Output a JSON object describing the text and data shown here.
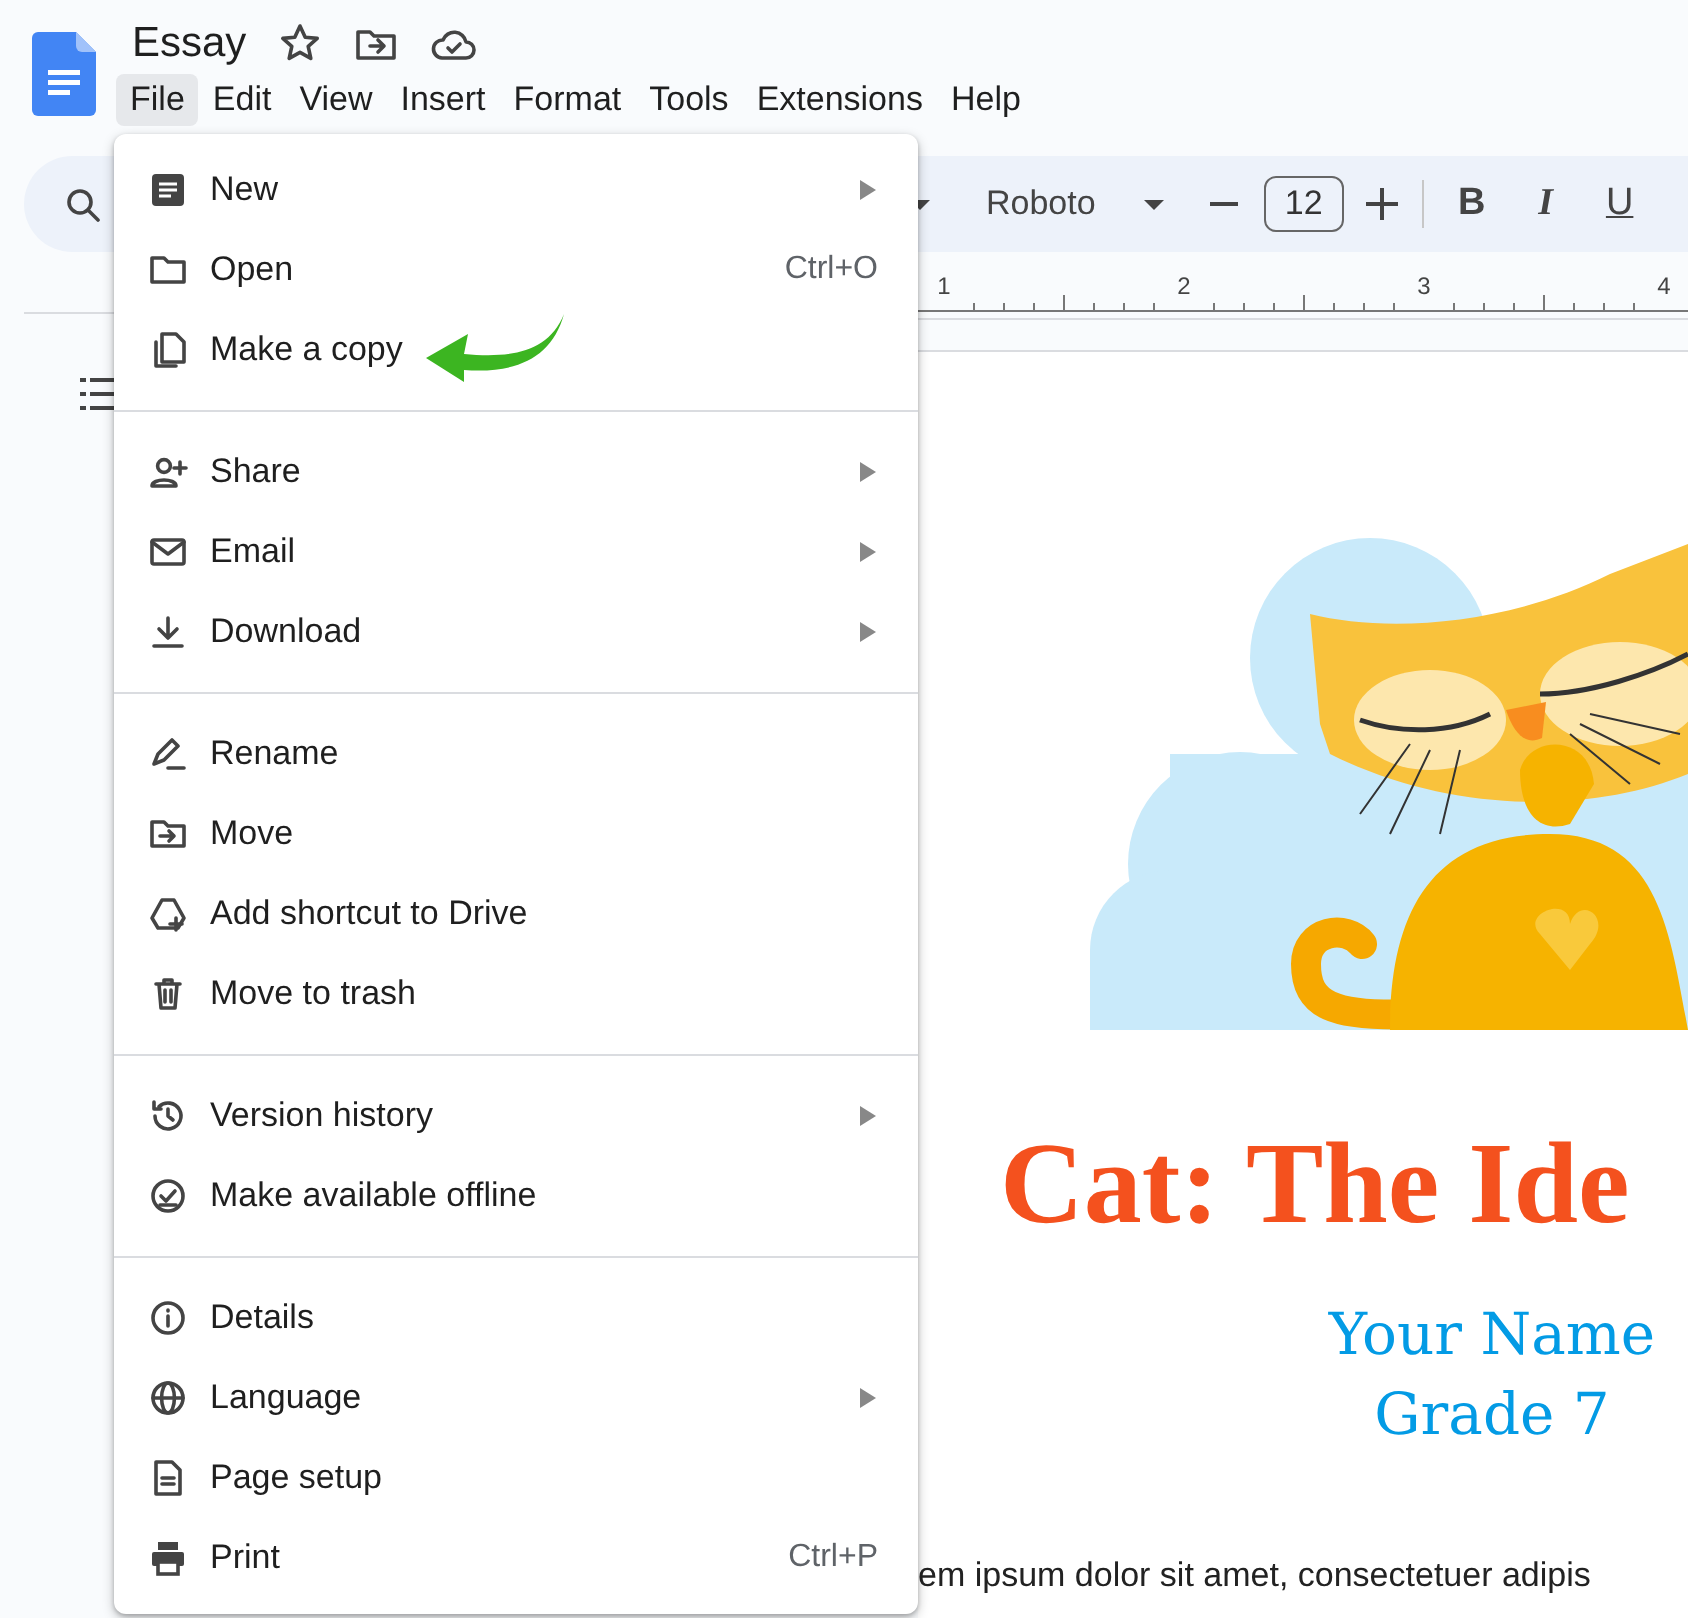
{
  "document": {
    "title": "Essay"
  },
  "menubar": [
    {
      "label": "File",
      "selected": true
    },
    {
      "label": "Edit",
      "selected": false
    },
    {
      "label": "View",
      "selected": false
    },
    {
      "label": "Insert",
      "selected": false
    },
    {
      "label": "Format",
      "selected": false
    },
    {
      "label": "Tools",
      "selected": false
    },
    {
      "label": "Extensions",
      "selected": false
    },
    {
      "label": "Help",
      "selected": false
    }
  ],
  "toolbar": {
    "font": "Roboto",
    "font_size": "12",
    "styles": [
      {
        "label": "B",
        "kind": "bold"
      },
      {
        "label": "I",
        "kind": "italic"
      },
      {
        "label": "U",
        "kind": "underline"
      }
    ]
  },
  "ruler": {
    "numbers": [
      "1",
      "2",
      "3",
      "4"
    ]
  },
  "file_menu": {
    "sections": [
      [
        {
          "label": "New",
          "submenu": true
        },
        {
          "label": "Open",
          "shortcut": "Ctrl+O",
          "submenu": false
        },
        {
          "label": "Make a copy",
          "submenu": false
        }
      ],
      [
        {
          "label": "Share",
          "submenu": true
        },
        {
          "label": "Email",
          "submenu": true
        },
        {
          "label": "Download",
          "submenu": true
        }
      ],
      [
        {
          "label": "Rename",
          "submenu": false
        },
        {
          "label": "Move",
          "submenu": false
        },
        {
          "label": "Add shortcut to Drive",
          "submenu": false
        },
        {
          "label": "Move to trash",
          "submenu": false
        }
      ],
      [
        {
          "label": "Version history",
          "submenu": true
        },
        {
          "label": "Make available offline",
          "submenu": false
        }
      ],
      [
        {
          "label": "Details",
          "submenu": false
        },
        {
          "label": "Language",
          "submenu": true
        },
        {
          "label": "Page setup",
          "submenu": false
        },
        {
          "label": "Print",
          "shortcut": "Ctrl+P",
          "submenu": false
        }
      ]
    ]
  },
  "page": {
    "title": "Cat: The Ide",
    "author": "Your Name",
    "grade": "Grade 7",
    "body": "em ipsum dolor sit amet, consectetuer adipis"
  }
}
